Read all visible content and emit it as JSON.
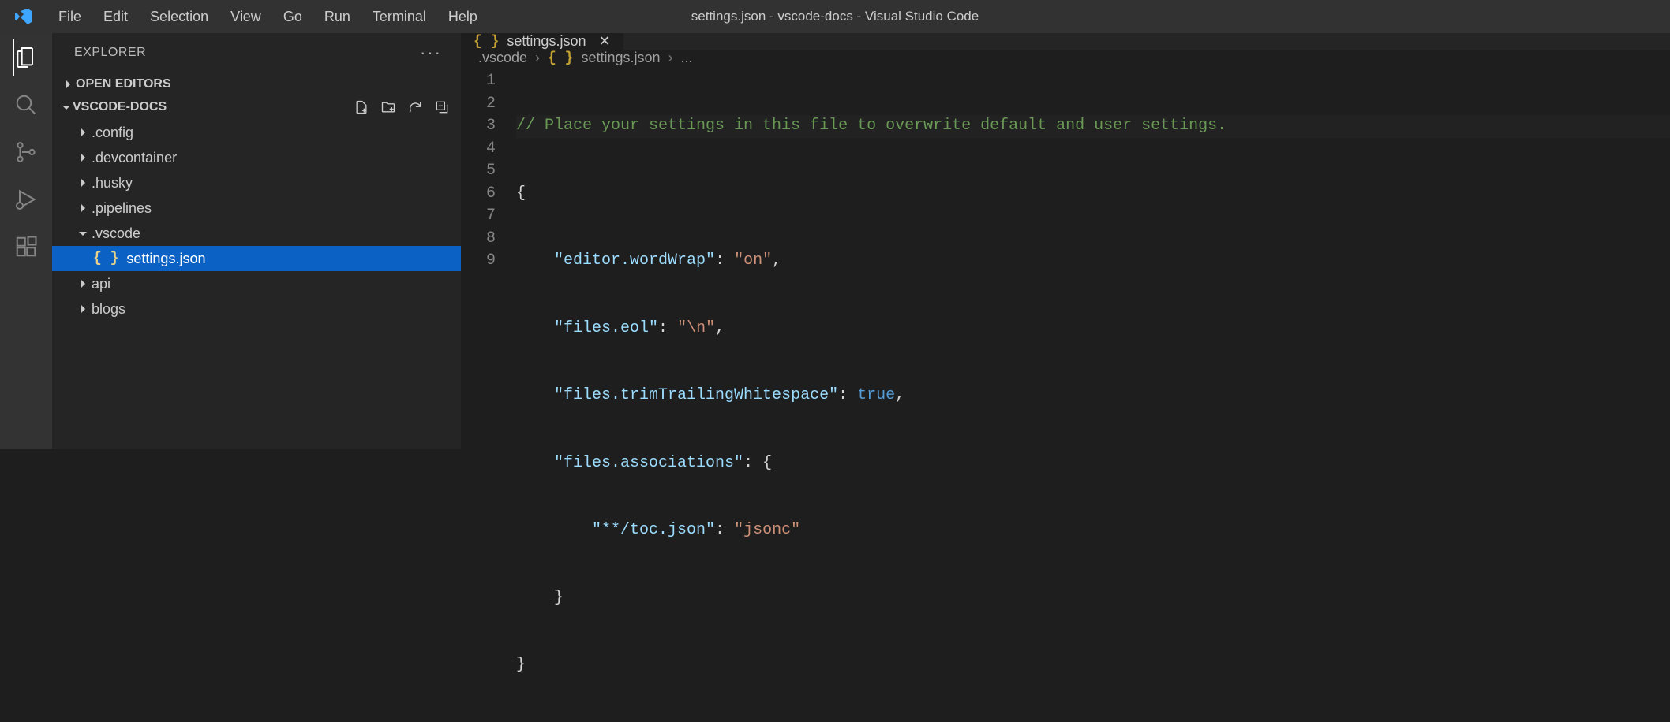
{
  "title": "settings.json - vscode-docs - Visual Studio Code",
  "menu": [
    "File",
    "Edit",
    "Selection",
    "View",
    "Go",
    "Run",
    "Terminal",
    "Help"
  ],
  "sidebar": {
    "title": "EXPLORER",
    "openEditors": "OPEN EDITORS",
    "workspace": "VSCODE-DOCS",
    "tree": [
      {
        "label": ".config",
        "type": "folder"
      },
      {
        "label": ".devcontainer",
        "type": "folder"
      },
      {
        "label": ".husky",
        "type": "folder"
      },
      {
        "label": ".pipelines",
        "type": "folder"
      },
      {
        "label": ".vscode",
        "type": "folder",
        "expanded": true
      },
      {
        "label": "settings.json",
        "type": "file",
        "selected": true
      },
      {
        "label": "api",
        "type": "folder"
      },
      {
        "label": "blogs",
        "type": "folder"
      }
    ]
  },
  "tab": {
    "label": "settings.json"
  },
  "breadcrumb": {
    "folder": ".vscode",
    "file": "settings.json",
    "tail": "..."
  },
  "code": {
    "lineNumbers": [
      "1",
      "2",
      "3",
      "4",
      "5",
      "6",
      "7",
      "8",
      "9"
    ],
    "l1_comment": "// Place your settings in this file to overwrite default and user settings.",
    "l2": "{",
    "l3_key": "\"editor.wordWrap\"",
    "l3_val": "\"on\"",
    "l4_key": "\"files.eol\"",
    "l4_val": "\"\\n\"",
    "l5_key": "\"files.trimTrailingWhitespace\"",
    "l5_val": "true",
    "l6_key": "\"files.associations\"",
    "l7_key": "\"**/toc.json\"",
    "l7_val": "\"jsonc\"",
    "l8": "    }",
    "l9": "}"
  }
}
